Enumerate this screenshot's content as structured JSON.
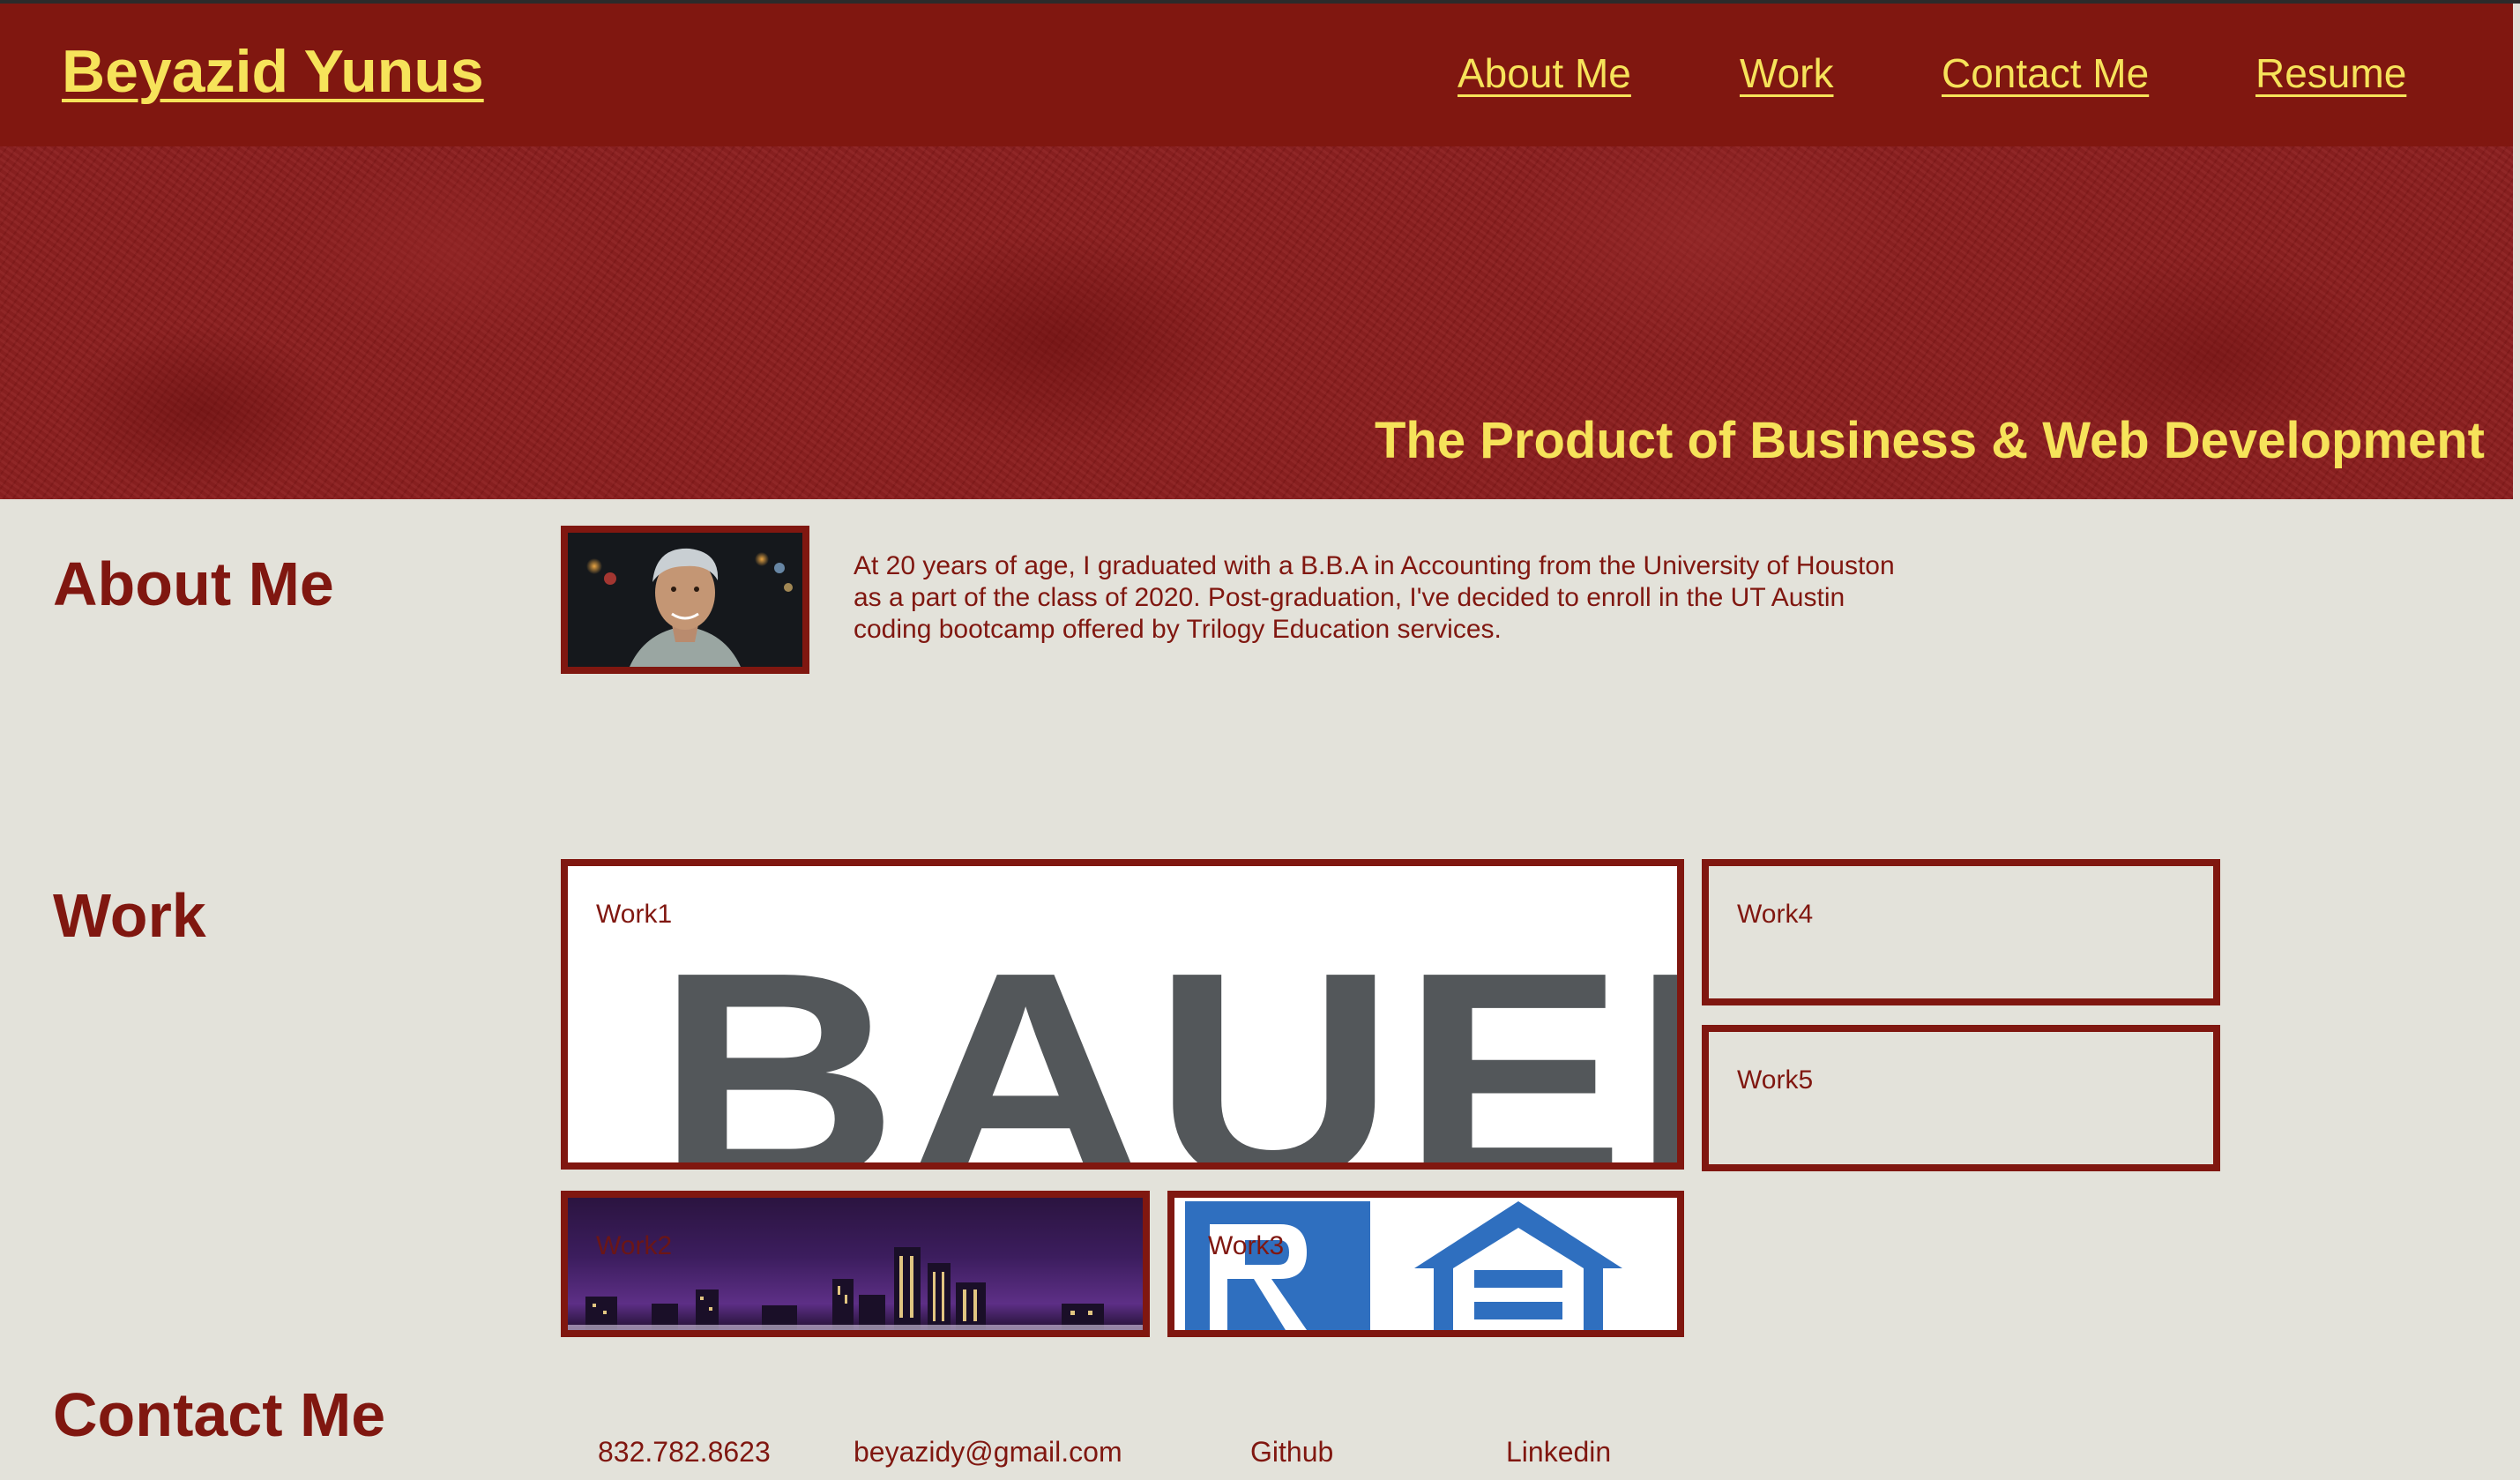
{
  "header": {
    "brand": "Beyazid Yunus",
    "nav": [
      "About Me",
      "Work",
      "Contact Me",
      "Resume"
    ]
  },
  "hero": {
    "tagline": "The Product of Business & Web Development"
  },
  "about": {
    "title": "About Me",
    "text": "At 20 years of age, I graduated with a B.B.A in Accounting from the University of Houston as a part of the class of 2020. Post-graduation, I've decided to enroll in the UT Austin coding bootcamp offered by Trilogy Education services."
  },
  "work": {
    "title": "Work",
    "cards": [
      {
        "label": "Work1",
        "logo_text": "BAUER"
      },
      {
        "label": "Work2"
      },
      {
        "label": "Work3"
      },
      {
        "label": "Work4"
      },
      {
        "label": "Work5"
      }
    ]
  },
  "contact": {
    "title": "Contact Me",
    "items": [
      "832.782.8623",
      "beyazidy@gmail.com",
      "Github",
      "Linkedin"
    ]
  },
  "colors": {
    "primary": "#801710",
    "accent": "#f6e35a",
    "background": "#e3e2da"
  }
}
